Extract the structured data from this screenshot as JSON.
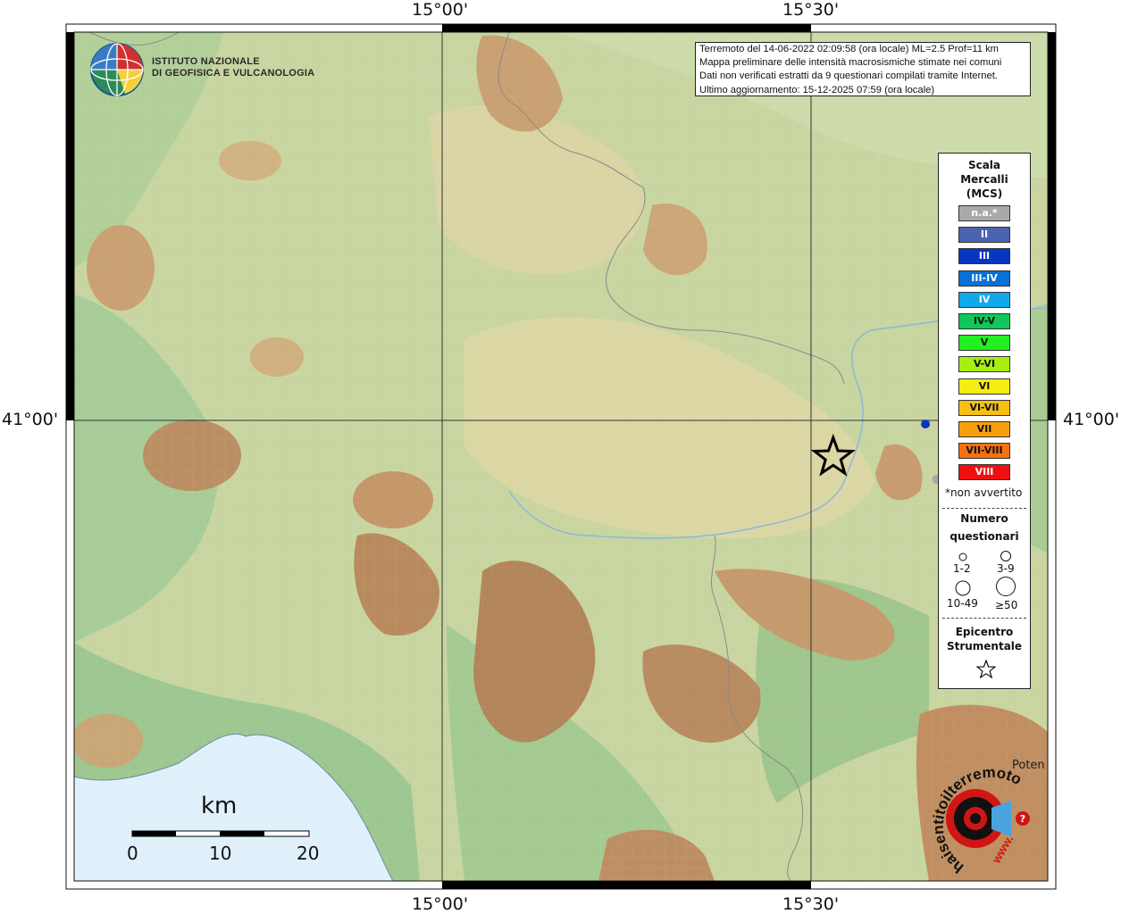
{
  "map": {
    "coordinates": {
      "top": [
        "15°00'",
        "15°30'"
      ],
      "bottom": [
        "15°00'",
        "15°30'"
      ],
      "left": "41°00'",
      "right": "41°00'"
    }
  },
  "info": {
    "line1": "Terremoto del 14-06-2022 02:09:58 (ora locale) ML=2.5 Prof=11 km",
    "line2": "Mappa preliminare delle intensità macrosismiche stimate nei comuni",
    "line3": "Dati non verificati estratti da 9 questionari compilati tramite Internet.",
    "line4": "Ultimo aggiornamento: 15-12-2025 07:59 (ora locale)"
  },
  "logo": {
    "line1": "ISTITUTO NAZIONALE",
    "line2": "DI GEOFISICA E VULCANOLOGIA"
  },
  "legend": {
    "title": [
      "Scala",
      "Mercalli",
      "(MCS)"
    ],
    "levels": [
      {
        "label": "n.a.*",
        "color": "#a9a9a9",
        "text_color": "#ffffff"
      },
      {
        "label": "II",
        "color": "#4a64b0",
        "text_color": "#ffffff"
      },
      {
        "label": "III",
        "color": "#0a35c0",
        "text_color": "#ffffff"
      },
      {
        "label": "III-IV",
        "color": "#0a6fd6",
        "text_color": "#ffffff"
      },
      {
        "label": "IV",
        "color": "#12a8ee",
        "text_color": "#ffffff"
      },
      {
        "label": "IV-V",
        "color": "#10c85a",
        "text_color": "#111111"
      },
      {
        "label": "V",
        "color": "#22ee22",
        "text_color": "#111111"
      },
      {
        "label": "V-VI",
        "color": "#a8ee10",
        "text_color": "#111111"
      },
      {
        "label": "VI",
        "color": "#f6ee10",
        "text_color": "#111111"
      },
      {
        "label": "VI-VII",
        "color": "#f6c012",
        "text_color": "#111111"
      },
      {
        "label": "VII",
        "color": "#f6a010",
        "text_color": "#111111"
      },
      {
        "label": "VII-VIII",
        "color": "#f67010",
        "text_color": "#111111"
      },
      {
        "label": "VIII",
        "color": "#ee1010",
        "text_color": "#ffffff"
      }
    ],
    "not_felt": "*non avvertito",
    "questionnaires_title": [
      "Numero",
      "questionari"
    ],
    "sizes": [
      "1-2",
      "3-9",
      "10-49",
      "≥50"
    ],
    "epicenter_title": [
      "Epicentro",
      "Strumentale"
    ]
  },
  "scalebar": {
    "unit": "km",
    "labels": [
      "0",
      "10",
      "20"
    ]
  },
  "place": "Poten",
  "hsit_logo": {
    "arc_text": "haisentitoilterremoto.it",
    "www": "www."
  },
  "markers": {
    "epicenter": {
      "lon": 15.53,
      "lat": 40.95
    },
    "points": [
      {
        "lon": 15.655,
        "lat": 40.995,
        "color": "#0a35c0"
      },
      {
        "lon": 15.67,
        "lat": 40.92,
        "color": "#a9a9a9"
      }
    ]
  }
}
